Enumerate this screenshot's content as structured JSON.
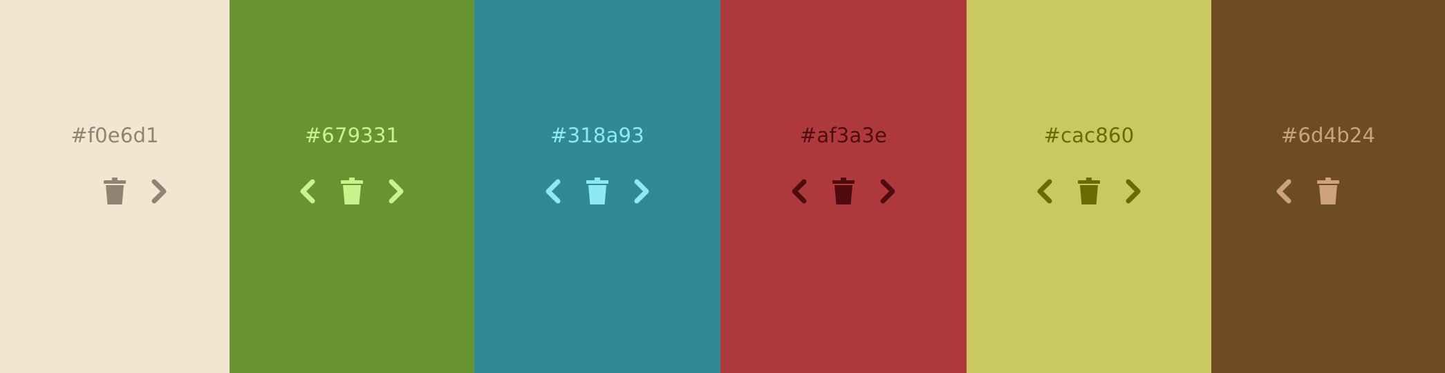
{
  "swatches": [
    {
      "hex": "#f0e6d1",
      "bg": "#f0e6d1",
      "fg": "#8f8371",
      "has_prev": false,
      "has_next": true,
      "icons": {
        "prev": "chevron-left-icon",
        "delete": "trash-icon",
        "next": "chevron-right-icon"
      }
    },
    {
      "hex": "#679331",
      "bg": "#679331",
      "fg": "#c9f48d",
      "has_prev": true,
      "has_next": true,
      "icons": {
        "prev": "chevron-left-icon",
        "delete": "trash-icon",
        "next": "chevron-right-icon"
      }
    },
    {
      "hex": "#318a93",
      "bg": "#318a93",
      "fg": "#8de9f4",
      "has_prev": true,
      "has_next": true,
      "icons": {
        "prev": "chevron-left-icon",
        "delete": "trash-icon",
        "next": "chevron-right-icon"
      }
    },
    {
      "hex": "#af3a3e",
      "bg": "#af3a3e",
      "fg": "#4f0b0d",
      "has_prev": true,
      "has_next": true,
      "icons": {
        "prev": "chevron-left-icon",
        "delete": "trash-icon",
        "next": "chevron-right-icon"
      }
    },
    {
      "hex": "#cac860",
      "bg": "#cac860",
      "fg": "#6b6a00",
      "has_prev": true,
      "has_next": true,
      "icons": {
        "prev": "chevron-left-icon",
        "delete": "trash-icon",
        "next": "chevron-right-icon"
      }
    },
    {
      "hex": "#6d4b24",
      "bg": "#6d4b24",
      "fg": "#cfa27f",
      "has_prev": true,
      "has_next": false,
      "icons": {
        "prev": "chevron-left-icon",
        "delete": "trash-icon",
        "next": "chevron-right-icon"
      }
    }
  ]
}
